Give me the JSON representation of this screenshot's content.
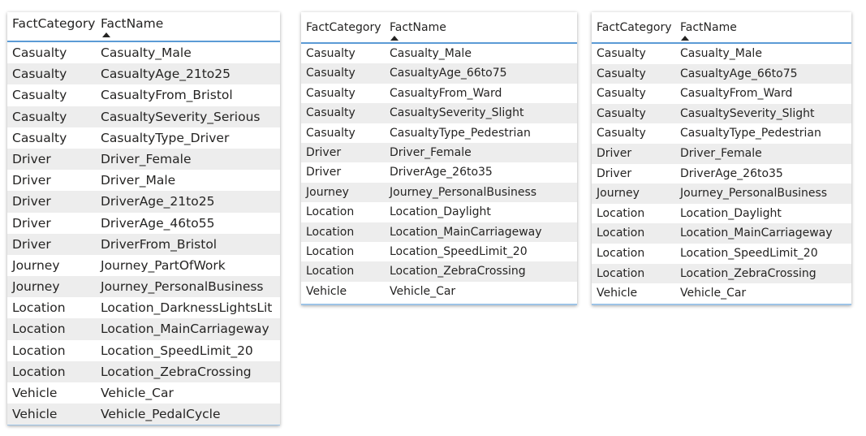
{
  "tables": [
    {
      "headers": [
        "FactCategory",
        "FactName"
      ],
      "rows": [
        [
          "Casualty",
          "Casualty_Male"
        ],
        [
          "Casualty",
          "CasualtyAge_21to25"
        ],
        [
          "Casualty",
          "CasualtyFrom_Bristol"
        ],
        [
          "Casualty",
          "CasualtySeverity_Serious"
        ],
        [
          "Casualty",
          "CasualtyType_Driver"
        ],
        [
          "Driver",
          "Driver_Female"
        ],
        [
          "Driver",
          "Driver_Male"
        ],
        [
          "Driver",
          "DriverAge_21to25"
        ],
        [
          "Driver",
          "DriverAge_46to55"
        ],
        [
          "Driver",
          "DriverFrom_Bristol"
        ],
        [
          "Journey",
          "Journey_PartOfWork"
        ],
        [
          "Journey",
          "Journey_PersonalBusiness"
        ],
        [
          "Location",
          "Location_DarknessLightsLit"
        ],
        [
          "Location",
          "Location_MainCarriageway"
        ],
        [
          "Location",
          "Location_SpeedLimit_20"
        ],
        [
          "Location",
          "Location_ZebraCrossing"
        ],
        [
          "Vehicle",
          "Vehicle_Car"
        ],
        [
          "Vehicle",
          "Vehicle_PedalCycle"
        ]
      ]
    },
    {
      "headers": [
        "FactCategory",
        "FactName"
      ],
      "rows": [
        [
          "Casualty",
          "Casualty_Male"
        ],
        [
          "Casualty",
          "CasualtyAge_66to75"
        ],
        [
          "Casualty",
          "CasualtyFrom_Ward"
        ],
        [
          "Casualty",
          "CasualtySeverity_Slight"
        ],
        [
          "Casualty",
          "CasualtyType_Pedestrian"
        ],
        [
          "Driver",
          "Driver_Female"
        ],
        [
          "Driver",
          "DriverAge_26to35"
        ],
        [
          "Journey",
          "Journey_PersonalBusiness"
        ],
        [
          "Location",
          "Location_Daylight"
        ],
        [
          "Location",
          "Location_MainCarriageway"
        ],
        [
          "Location",
          "Location_SpeedLimit_20"
        ],
        [
          "Location",
          "Location_ZebraCrossing"
        ],
        [
          "Vehicle",
          "Vehicle_Car"
        ]
      ]
    },
    {
      "headers": [
        "FactCategory",
        "FactName"
      ],
      "rows": [
        [
          "Casualty",
          "Casualty_Male"
        ],
        [
          "Casualty",
          "CasualtyAge_66to75"
        ],
        [
          "Casualty",
          "CasualtyFrom_Ward"
        ],
        [
          "Casualty",
          "CasualtySeverity_Slight"
        ],
        [
          "Casualty",
          "CasualtyType_Pedestrian"
        ],
        [
          "Driver",
          "Driver_Female"
        ],
        [
          "Driver",
          "DriverAge_26to35"
        ],
        [
          "Journey",
          "Journey_PersonalBusiness"
        ],
        [
          "Location",
          "Location_Daylight"
        ],
        [
          "Location",
          "Location_MainCarriageway"
        ],
        [
          "Location",
          "Location_SpeedLimit_20"
        ],
        [
          "Location",
          "Location_ZebraCrossing"
        ],
        [
          "Vehicle",
          "Vehicle_Car"
        ]
      ]
    }
  ],
  "sort_icon": "sort-ascending-icon",
  "colors": {
    "header_border": "#5b9bd5",
    "alt_row": "#ededed",
    "text": "#252423"
  }
}
